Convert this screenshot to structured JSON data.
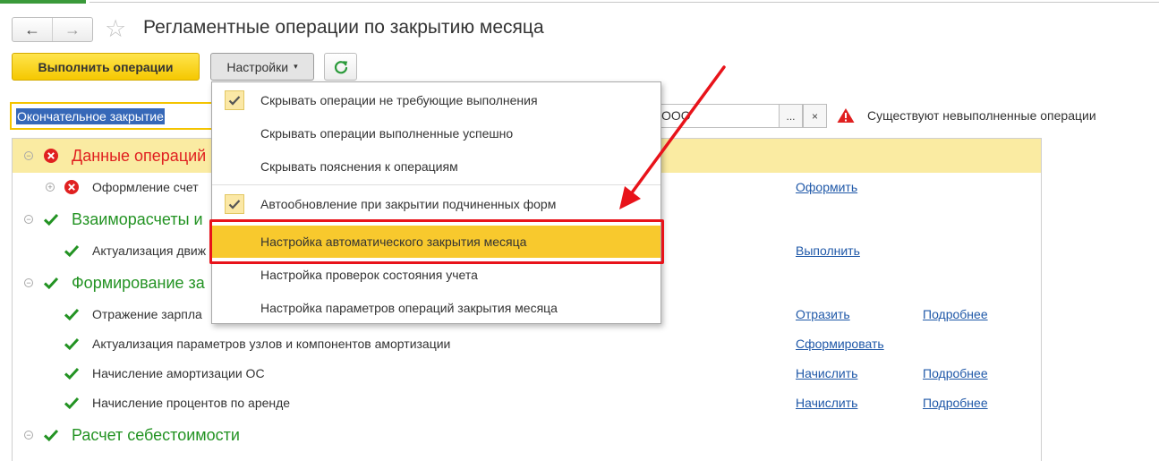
{
  "header": {
    "back_glyph": "←",
    "forward_glyph": "→",
    "star_glyph": "☆",
    "title": "Регламентные операции по закрытию месяца"
  },
  "toolbar": {
    "run_label": "Выполнить операции",
    "settings_label": "Настройки",
    "settings_arrow": "▾"
  },
  "filter": {
    "period_type_value": "Окончательное закрытие",
    "organization_value": "ООО",
    "select_glyph": "...",
    "clear_glyph": "×",
    "warning_text": "Существуют невыполненные операции"
  },
  "menu": {
    "items": [
      {
        "label": "Скрывать операции не требующие выполнения",
        "checked": true
      },
      {
        "label": "Скрывать операции выполненные успешно",
        "checked": false
      },
      {
        "label": "Скрывать пояснения к операциям",
        "checked": false
      },
      {
        "label": "Автообновление при закрытии подчиненных форм",
        "checked": true
      },
      {
        "label": "Настройка автоматического закрытия месяца",
        "checked": false
      },
      {
        "label": "Настройка проверок состояния учета",
        "checked": false
      },
      {
        "label": "Настройка параметров операций закрытия месяца",
        "checked": false
      }
    ]
  },
  "tree": {
    "expanded_glyph": "−",
    "collapsed_glyph": "+",
    "groups": [
      {
        "label": "Данные операций",
        "status": "error"
      },
      {
        "label": "Взаиморасчеты и",
        "status": "ok"
      },
      {
        "label": "Формирование за",
        "status": "ok"
      },
      {
        "label": "Расчет себестоимости",
        "status": "ok"
      }
    ],
    "items": [
      {
        "label": "Оформление счет",
        "status": "error",
        "action": "Оформить",
        "details": ""
      },
      {
        "label": "Актуализация движ",
        "status": "ok",
        "action": "Выполнить",
        "details": ""
      },
      {
        "label": "Отражение зарпла",
        "status": "ok",
        "action": "Отразить",
        "details": "Подробнее"
      },
      {
        "label": "Актуализация параметров узлов и компонентов амортизации",
        "status": "ok",
        "action": "Сформировать",
        "details": ""
      },
      {
        "label": "Начисление амортизации ОС",
        "status": "ok",
        "action": "Начислить",
        "details": "Подробнее"
      },
      {
        "label": "Начисление процентов по аренде",
        "status": "ok",
        "action": "Начислить",
        "details": "Подробнее"
      }
    ]
  },
  "colors": {
    "accent_yellow": "#f5c800",
    "error_red": "#e02020",
    "ok_green": "#239323",
    "link_blue": "#1f58a8",
    "annotation_red": "#e8131a"
  }
}
